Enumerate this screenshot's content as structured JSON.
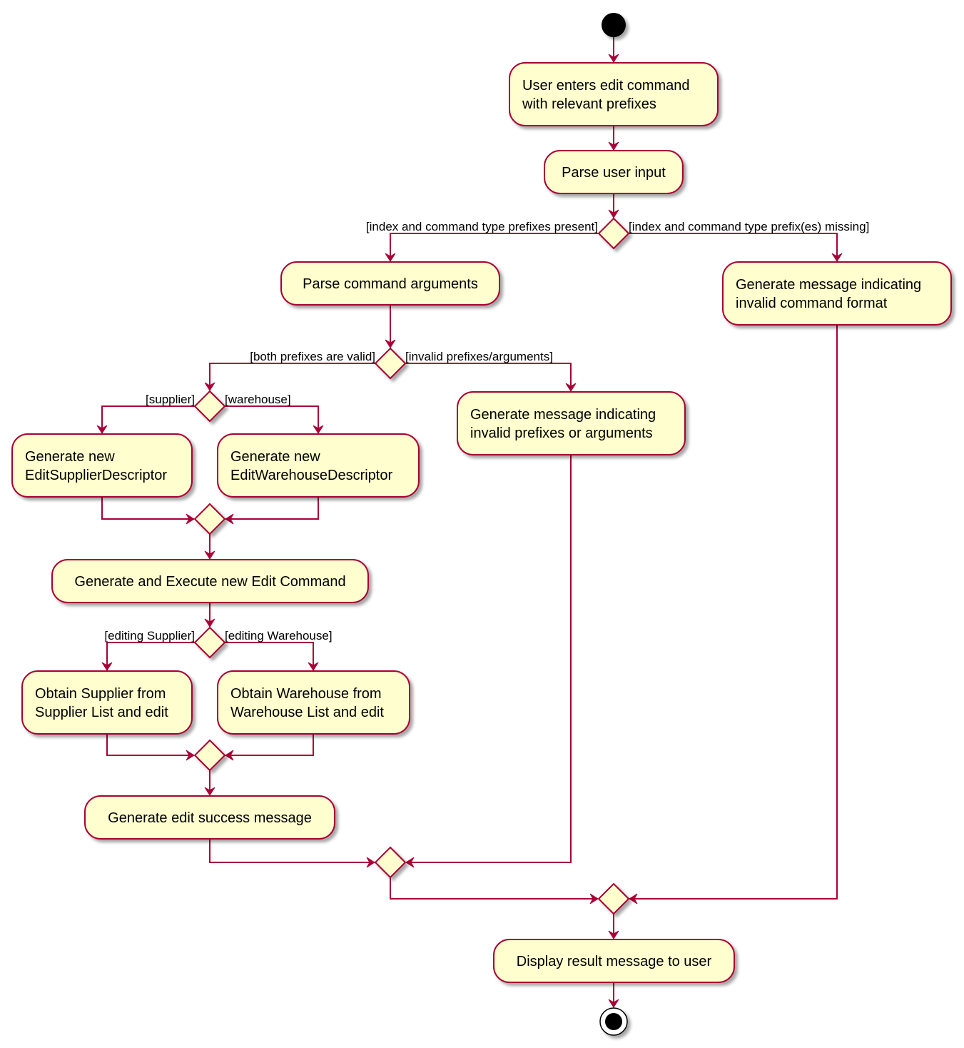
{
  "colors": {
    "border": "#A80036",
    "fill": "#FEFECE",
    "shadow": "#b5b5b5",
    "node": "#000000"
  },
  "activities": {
    "enter_cmd": [
      "User enters edit command",
      "with relevant prefixes"
    ],
    "parse_input": [
      "Parse user input"
    ],
    "parse_args": [
      "Parse command arguments"
    ],
    "invalid_format": [
      "Generate message indicating",
      "invalid command format"
    ],
    "invalid_args": [
      "Generate message indicating",
      "invalid prefixes or arguments"
    ],
    "supplier_desc": [
      "Generate new",
      "EditSupplierDescriptor"
    ],
    "warehouse_desc": [
      "Generate new",
      "EditWarehouseDescriptor"
    ],
    "execute": [
      "Generate and Execute new Edit Command"
    ],
    "obtain_supplier": [
      "Obtain Supplier from",
      "Supplier List and edit"
    ],
    "obtain_warehouse": [
      "Obtain Warehouse from",
      "Warehouse List and edit"
    ],
    "success": [
      "Generate edit success message"
    ],
    "display": [
      "Display result message to user"
    ]
  },
  "guards": {
    "prefixes_present": "[index and command type prefixes present]",
    "prefixes_missing": "[index and command type prefix(es) missing]",
    "both_valid": "[both prefixes are valid]",
    "invalid_args": "[invalid prefixes/arguments]",
    "supplier": "[supplier]",
    "warehouse": "[warehouse]",
    "editing_supplier": "[editing Supplier]",
    "editing_warehouse": "[editing Warehouse]"
  }
}
